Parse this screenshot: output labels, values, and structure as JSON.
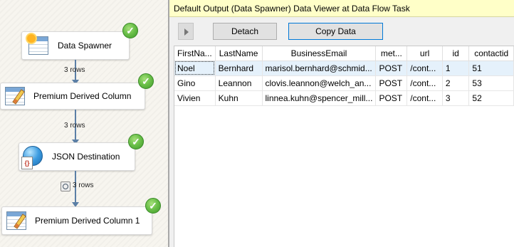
{
  "designer": {
    "nodes": [
      {
        "label": "Data Spawner",
        "status": "success"
      },
      {
        "label": "Premium Derived Column",
        "status": "success"
      },
      {
        "label": "JSON Destination",
        "status": "success"
      },
      {
        "label": "Premium Derived Column 1",
        "status": "success"
      }
    ],
    "paths": [
      {
        "label": "3 rows"
      },
      {
        "label": "3 rows"
      },
      {
        "label": "3 rows"
      }
    ],
    "check_glyph": "✓",
    "json_glyph": "{}"
  },
  "viewer": {
    "title": "Default Output (Data Spawner) Data Viewer at Data Flow Task",
    "detach_label": "Detach",
    "copy_label": "Copy Data",
    "columns": [
      "FirstNa...",
      "LastName",
      "BusinessEmail",
      "met...",
      "url",
      "id",
      "contactid"
    ],
    "rows": [
      [
        "Noel",
        "Bernhard",
        "marisol.bernhard@schmid...",
        "POST",
        "/cont...",
        "1",
        "51"
      ],
      [
        "Gino",
        "Leannon",
        "clovis.leannon@welch_an...",
        "POST",
        "/cont...",
        "2",
        "53"
      ],
      [
        "Vivien",
        "Kuhn",
        "linnea.kuhn@spencer_mill...",
        "POST",
        "/cont...",
        "3",
        "52"
      ]
    ]
  }
}
